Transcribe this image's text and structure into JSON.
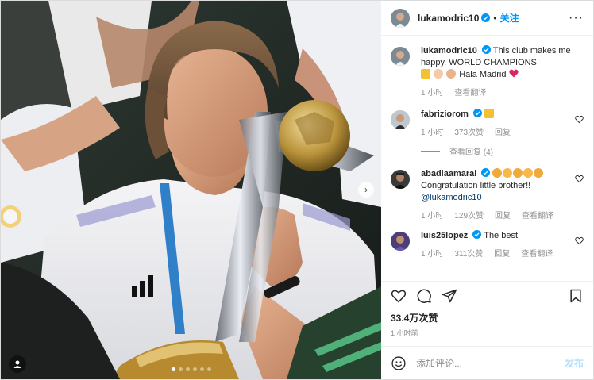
{
  "colors": {
    "accent": "#0095f6",
    "verified": "#0095f6",
    "meta": "#8e8e8e",
    "heart_red": "#ed4956"
  },
  "carousel": {
    "slide_count": 6,
    "active_index": 0
  },
  "header": {
    "username": "lukamodric10",
    "separator": "•",
    "follow_label": "关注",
    "more_label": "···"
  },
  "caption": {
    "username": "lukamodric10",
    "text_line1": "This club makes me happy. WORLD CHAMPIONS",
    "text_line2": "Hala Madrid",
    "emojis": [
      "trophy-emoji",
      "raised-hand-emoji",
      "praying-hands-emoji"
    ],
    "time": "1 小时",
    "translate": "查看翻译"
  },
  "comments": [
    {
      "username": "fabriziorom",
      "text": "",
      "emoji": "trophy-emoji",
      "time": "1 小时",
      "likes": "373次赞",
      "reply": "回复",
      "view_replies": "查看回复 (4)"
    },
    {
      "username": "abadiaamaral",
      "text": "Congratulation little brother!!",
      "mention": "@lukamodric10",
      "emoji_count": 5,
      "time": "1 小时",
      "likes": "129次赞",
      "reply": "回复",
      "translate": "查看翻译"
    },
    {
      "username": "luis25lopez",
      "text": "The best",
      "time": "1 小时",
      "likes": "311次赞",
      "reply": "回复",
      "translate": "查看翻译"
    }
  ],
  "footer": {
    "likes": "33.4万次赞",
    "time": "1 小时前",
    "comment_placeholder": "添加评论...",
    "post_label": "发布"
  }
}
